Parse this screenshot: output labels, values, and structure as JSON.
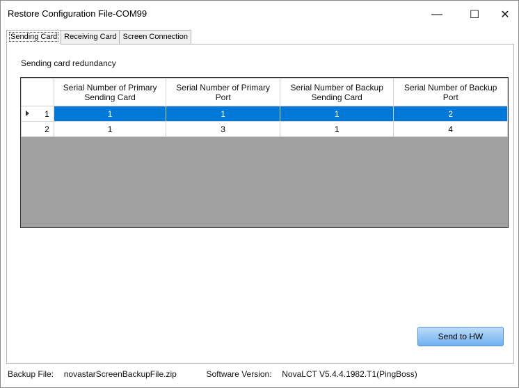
{
  "window": {
    "title": "Restore Configuration File-COM99",
    "minimize": "—",
    "maximize": "☐",
    "close": "✕"
  },
  "tabs": [
    {
      "label": "Sending Card",
      "active": true
    },
    {
      "label": "Receiving Card",
      "active": false
    },
    {
      "label": "Screen Connection",
      "active": false
    }
  ],
  "section": {
    "label": "Sending card redundancy"
  },
  "table": {
    "headers": [
      "Serial Number of Primary Sending Card",
      "Serial Number of Primary Port",
      "Serial Number of Backup Sending Card",
      "Serial Number of Backup Port"
    ],
    "rows": [
      {
        "index": "1",
        "cells": [
          "1",
          "1",
          "1",
          "2"
        ],
        "selected": true
      },
      {
        "index": "2",
        "cells": [
          "1",
          "3",
          "1",
          "4"
        ],
        "selected": false
      }
    ]
  },
  "buttons": {
    "send_to_hw": "Send to HW"
  },
  "status": {
    "backup_label": "Backup File:",
    "backup_value": "novastarScreenBackupFile.zip",
    "software_label": "Software Version:",
    "software_value": "NovaLCT V5.4.4.1982.T1(PingBoss)"
  },
  "colors": {
    "selection": "#0078d7",
    "empty_grid": "#a0a0a0",
    "button_gradient_top": "#bcdcfa",
    "button_gradient_bottom": "#6fb0ee"
  }
}
